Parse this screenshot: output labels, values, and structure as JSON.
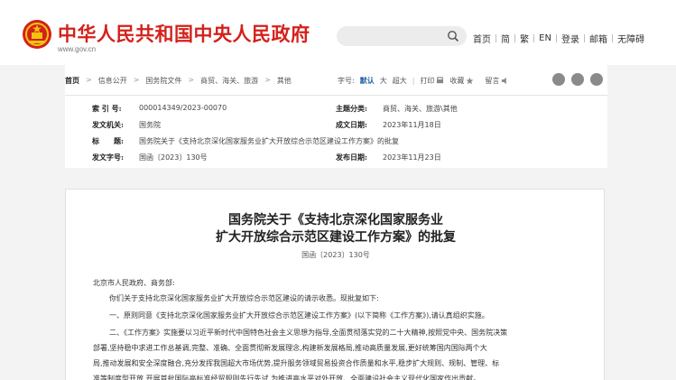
{
  "header": {
    "site_title": "中华人民共和国中央人民政府",
    "site_url": "www.gov.cn",
    "nav": [
      "首页",
      "简",
      "繁",
      "EN",
      "登录",
      "邮箱",
      "无障碍"
    ]
  },
  "breadcrumb": {
    "items": [
      "首页",
      "信息公开",
      "国务院文件",
      "商贸、海关、旅游",
      "其他"
    ]
  },
  "toolbar": {
    "font_label": "字号:",
    "font_sizes": [
      "默认",
      "大",
      "超大"
    ],
    "print": "打印",
    "favorite": "收藏",
    "listen": "留言"
  },
  "meta": {
    "index_label": "索 引 号:",
    "index_value": "000014349/2023-00070",
    "category_label": "主题分类:",
    "category_value": "商贸、海关、旅游\\其他",
    "issuer_label": "发文机关:",
    "issuer_value": "国务院",
    "written_label": "成文日期:",
    "written_value": "2023年11月18日",
    "title_label": "标　　题:",
    "title_value": "国务院关于《支持北京深化国家服务业扩大开放综合示范区建设工作方案》的批复",
    "docno_label": "发文字号:",
    "docno_value": "国函〔2023〕130号",
    "published_label": "发布日期:",
    "published_value": "2023年11月23日"
  },
  "document": {
    "title_line1": "国务院关于《支持北京深化国家服务业",
    "title_line2": "扩大开放综合示范区建设工作方案》的批复",
    "number": "国函〔2023〕130号",
    "addressee": "北京市人民政府、商务部:",
    "para1": "你们关于支持北京深化国家服务业扩大开放综合示范区建设的请示收悉。现批复如下:",
    "para2": "一、原则同意《支持北京深化国家服务业扩大开放综合示范区建设工作方案》(以下简称《工作方案》),请认真组织实施。",
    "para3_lines": [
      "二、《工作方案》实施要以习近平新时代中国特色社会主义思想为指导,全面贯彻落实党的二十大精神,按照党中央、国务院决策",
      "部署,坚持稳中求进工作总基调,完整、准确、全面贯彻新发展理念,构建新发展格局,推动高质量发展,更好统筹国内国际两个大",
      "局,推动发展和安全深度融合,充分发挥我国超大市场优势,提升服务领域贸易投资合作质量和水平,稳步扩大规则、规制、管理、标",
      "准等制度型开放,开展首批国际高标准经贸规则先行先试,为推进高水平对外开放、全面建设社会主义现代化国家作出贡献。"
    ]
  },
  "colors": {
    "brand_red": "#d4211b",
    "link_blue": "#1f5aa6"
  }
}
